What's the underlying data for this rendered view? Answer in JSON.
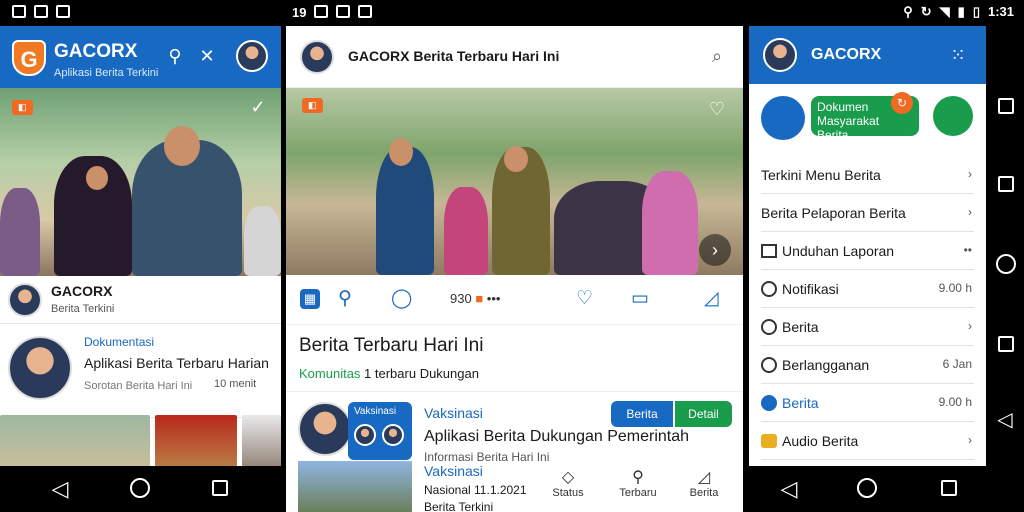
{
  "status_bar": {
    "time": "1:31",
    "left_center": "19",
    "icons": [
      "notification-icon",
      "image-icon",
      "settings-icon",
      "wifi-icon",
      "signal-icon",
      "battery-icon"
    ]
  },
  "app1": {
    "brand": "GACORX",
    "subtitle": "Aplikasi Berita Terkini",
    "user": {
      "name": "GACORX",
      "meta": "Berita  Terkini"
    },
    "card": {
      "category": "Dokumentasi",
      "title": "Aplikasi Berita Terbaru Harian",
      "meta": "Sorotan Berita Hari Ini",
      "right": "10 menit"
    }
  },
  "app2": {
    "title": "GACORX Berita Terbaru Hari Ini",
    "actions": {
      "count": "930"
    },
    "hero": {
      "title": "Berita Terbaru Hari Ini",
      "meta_green": "Komunitas",
      "meta_rest": "1  terbaru  Dukungan"
    },
    "story": {
      "category": "Vaksinasi",
      "title": "Aplikasi Berita Dukungan Pemerintah",
      "meta": "Informasi Berita Hari Ini",
      "btn_primary": "Berita",
      "btn_secondary": "Detail"
    },
    "story2": {
      "category": "Vaksinasi",
      "meta": "Nasional 11.1.2021",
      "meta2": "Berita Terkini"
    },
    "tabs": [
      "Status",
      "Terbaru",
      "Berita"
    ]
  },
  "app3": {
    "brand": "GACORX",
    "banner": {
      "line1": "Dokumen",
      "line2": "Masyarakat Berita"
    },
    "rows": [
      {
        "label": "Terkini  Menu  Berita",
        "right": ""
      },
      {
        "label": "Berita Pelaporan Berita",
        "right": ""
      },
      {
        "label": "Unduhan Laporan",
        "right": "••"
      },
      {
        "label": "Notifikasi",
        "right": "9.00 h"
      },
      {
        "label": "Berita",
        "right": ""
      },
      {
        "label": "Berlangganan",
        "right": "6 Jan"
      },
      {
        "label": "Berita",
        "right": "9.00 h"
      },
      {
        "label": "Audio Berita",
        "right": ""
      }
    ]
  },
  "colors": {
    "primary": "#1769c2",
    "accent": "#f06a24",
    "green": "#1a9c4d"
  }
}
